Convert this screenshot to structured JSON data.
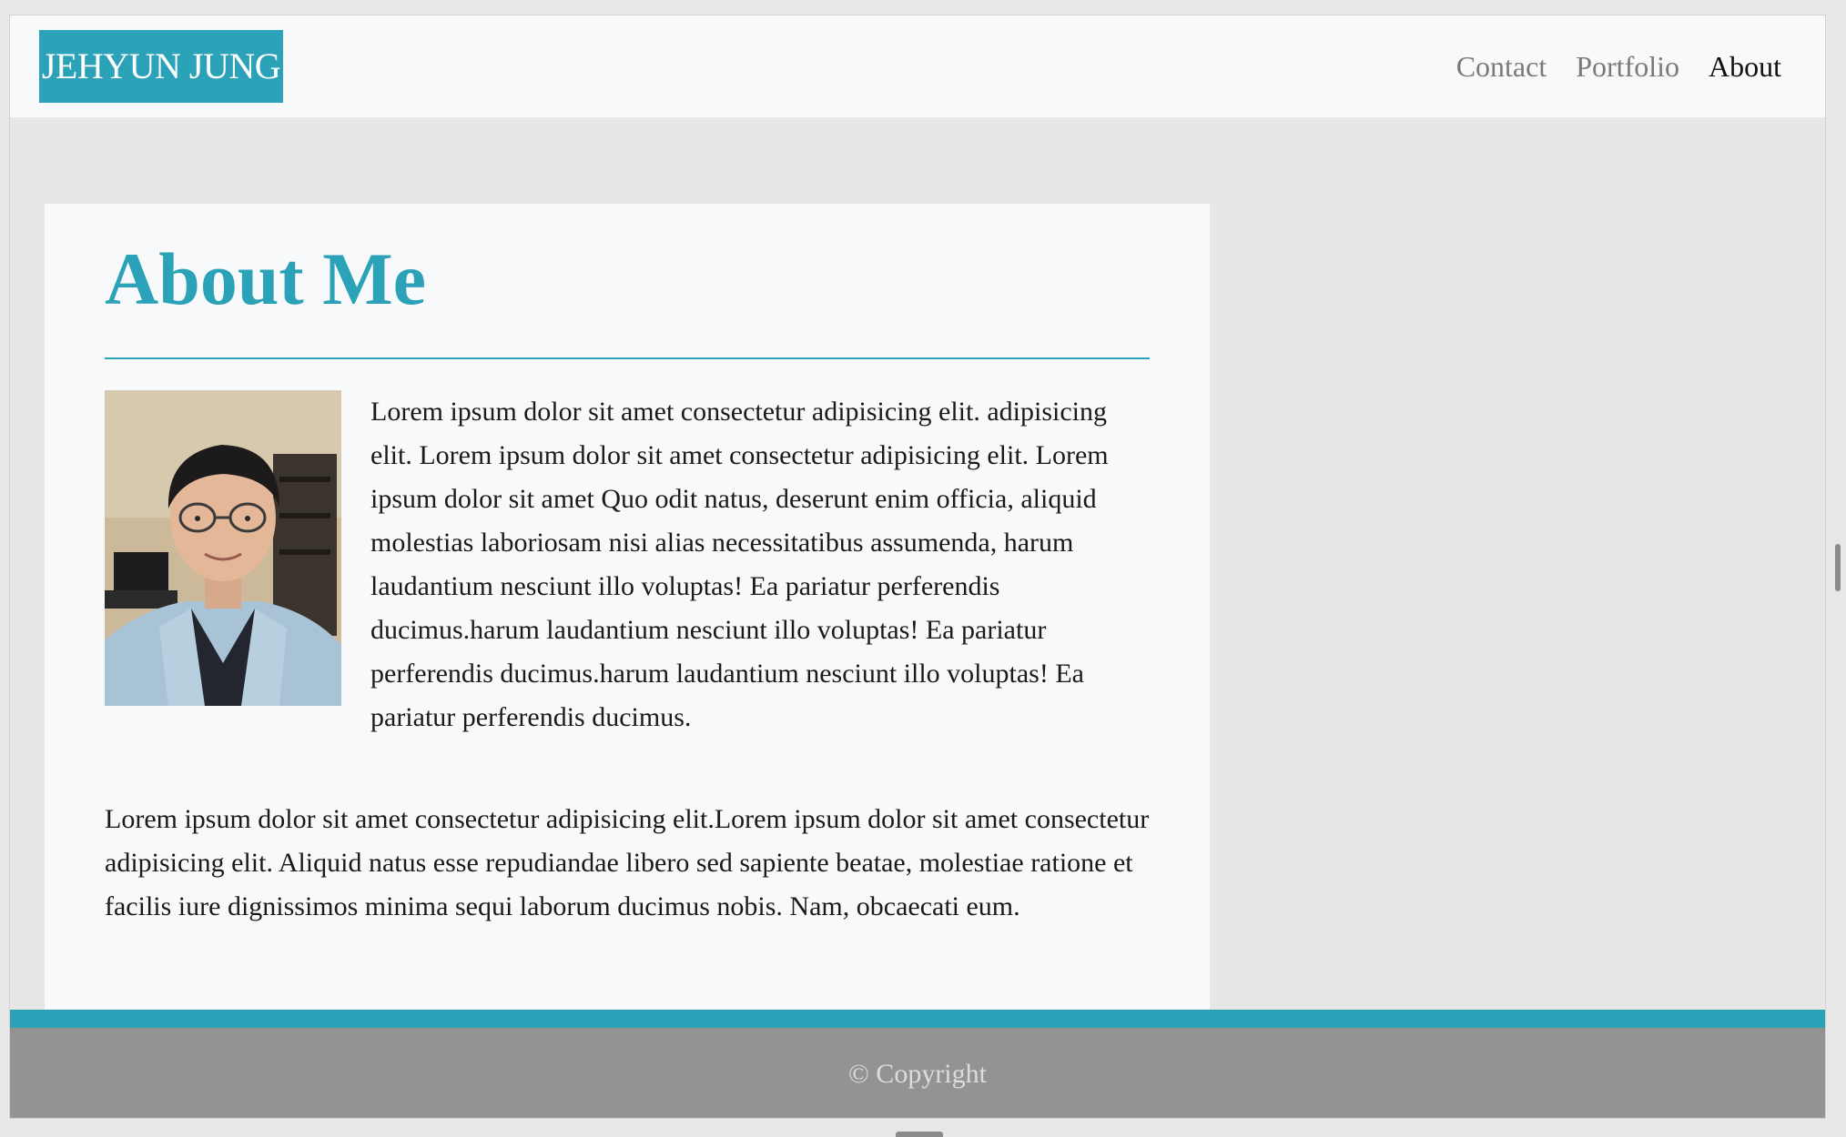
{
  "navbar": {
    "brand": "JEHYUN JUNG",
    "links": [
      {
        "label": "Contact",
        "active": false
      },
      {
        "label": "Portfolio",
        "active": false
      },
      {
        "label": "About",
        "active": true
      }
    ]
  },
  "about": {
    "title": "About Me",
    "paragraph1": "Lorem ipsum dolor sit amet consectetur adipisicing elit. adipisicing elit. Lorem ipsum dolor sit amet consectetur adipisicing elit. Lorem ipsum dolor sit amet Quo odit natus, deserunt enim officia, aliquid molestias laboriosam nisi alias necessitatibus assumenda, harum laudantium nesciunt illo voluptas! Ea pariatur perferendis ducimus.harum laudantium nesciunt illo voluptas! Ea pariatur perferendis ducimus.harum laudantium nesciunt illo voluptas! Ea pariatur perferendis ducimus.",
    "paragraph2": "Lorem ipsum dolor sit amet consectetur adipisicing elit.Lorem ipsum dolor sit amet consectetur adipisicing elit. Aliquid natus esse repudiandae libero sed sapiente beatae, molestiae ratione et facilis iure dignissimos minima sequi laborum ducimus nobis. Nam, obcaecati eum."
  },
  "footer": {
    "copyright": "© Copyright"
  },
  "colors": {
    "accent": "#2ba2b7",
    "navbar_bg": "#f8f9fa",
    "page_bg": "#e7e7e7",
    "footer_bg": "#939393"
  }
}
